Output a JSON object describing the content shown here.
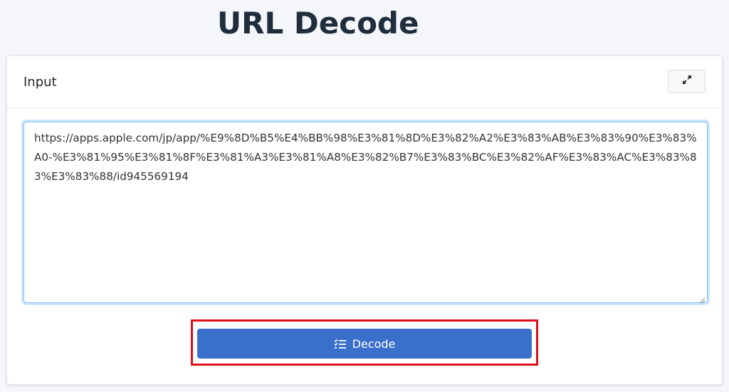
{
  "page": {
    "title": "URL Decode"
  },
  "input_card": {
    "title": "Input",
    "expand_icon": "expand-arrows-icon",
    "textarea_value": "https://apps.apple.com/jp/app/%E9%8D%B5%E4%BB%98%E3%81%8D%E3%82%A2%E3%83%AB%E3%83%90%E3%83%A0-%E3%81%95%E3%81%8F%E3%81%A3%E3%81%A8%E3%82%B7%E3%83%BC%E3%82%AF%E3%83%AC%E3%83%83%E3%83%88/id945569194"
  },
  "actions": {
    "decode_label": "Decode",
    "decode_icon": "list-check-icon",
    "highlight_color": "#e0101a",
    "button_color": "#3a6fcb"
  }
}
